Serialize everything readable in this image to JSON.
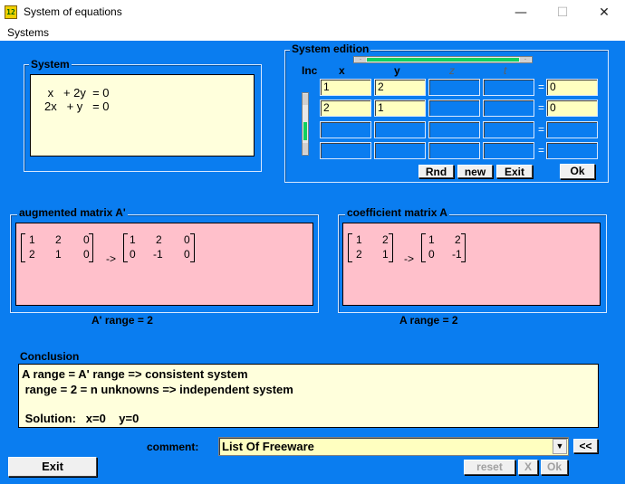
{
  "window": {
    "title": "System of equations",
    "minimize": "—",
    "maximize": "☐",
    "close": "✕"
  },
  "menu": {
    "systems": "Systems"
  },
  "system_panel": {
    "label": "System",
    "line1": " x   + 2y  = 0",
    "line2": "2x   + y   = 0"
  },
  "edition": {
    "label": "System edition",
    "inc": "Inc",
    "headers": [
      "x",
      "y",
      "z",
      "t"
    ],
    "rows": [
      {
        "cells": [
          "1",
          "2",
          "",
          ""
        ],
        "rhs": "0"
      },
      {
        "cells": [
          "2",
          "1",
          "",
          ""
        ],
        "rhs": "0"
      },
      {
        "cells": [
          "",
          "",
          "",
          ""
        ],
        "rhs": ""
      },
      {
        "cells": [
          "",
          "",
          "",
          ""
        ],
        "rhs": ""
      }
    ],
    "eq_sign": "=",
    "rnd": "Rnd",
    "new": "new",
    "exit": "Exit",
    "ok": "Ok"
  },
  "augmented": {
    "label": "augmented matrix A'",
    "left": [
      [
        "1",
        "2",
        "0"
      ],
      [
        "2",
        "1",
        "0"
      ]
    ],
    "arrow": "->",
    "right": [
      [
        "1",
        "2",
        "0"
      ],
      [
        "0",
        "-1",
        "0"
      ]
    ],
    "range": "A' range = 2"
  },
  "coefficient": {
    "label": "coefficient matrix  A",
    "left": [
      [
        "1",
        "2"
      ],
      [
        "2",
        "1"
      ]
    ],
    "arrow": "->",
    "right": [
      [
        "1",
        "2"
      ],
      [
        "0",
        "-1"
      ]
    ],
    "range": "A range = 2"
  },
  "conclusion": {
    "label": "Conclusion",
    "line1": "A range = A' range => consistent system",
    "line2": " range = 2 = n unknowns => independent system",
    "line3": " Solution:   x=0    y=0"
  },
  "comment": {
    "label": "comment:",
    "value": "List Of Freeware",
    "back": "<<"
  },
  "bottom": {
    "exit": "Exit",
    "reset": "reset",
    "x": "X",
    "ok": "Ok"
  },
  "colors": {
    "client": "#0a7df0",
    "pink": "#ffc0cb",
    "yellow": "#ffffdc"
  }
}
